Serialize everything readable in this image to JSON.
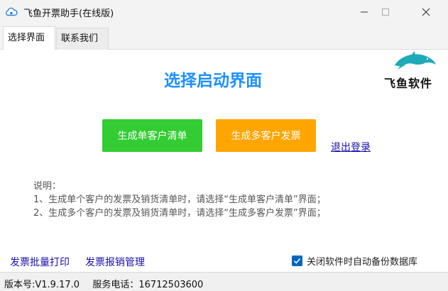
{
  "window": {
    "title": "飞鱼开票助手(在线版)"
  },
  "tabs": [
    {
      "label": "选择界面",
      "active": true
    },
    {
      "label": "联系我们",
      "active": false
    }
  ],
  "main": {
    "heading": "选择启动界面",
    "logo_text": "飞鱼软件",
    "button_single": "生成单客户清单",
    "button_multi": "生成多客户发票",
    "logout": "退出登录",
    "notes": [
      "说明：",
      "1、生成单个客户的发票及销货清单时，请选择“生成单客户清单”界面；",
      "2、生成多个客户的发票及销货清单时，请选择“生成多客户发票”界面；"
    ],
    "link_batch_print": "发票批量打印",
    "link_reimburse": "发票报销管理",
    "backup_label": "关闭软件时自动备份数据库",
    "backup_checked": true
  },
  "status": {
    "version": "版本号:V1.9.17.0",
    "phone": "服务电话：16712503600"
  },
  "colors": {
    "heading": "#1e90ff",
    "green_button": "#33cc33",
    "orange_button": "#ffa500",
    "link": "#1a0dab",
    "checkbox": "#0067c0"
  }
}
